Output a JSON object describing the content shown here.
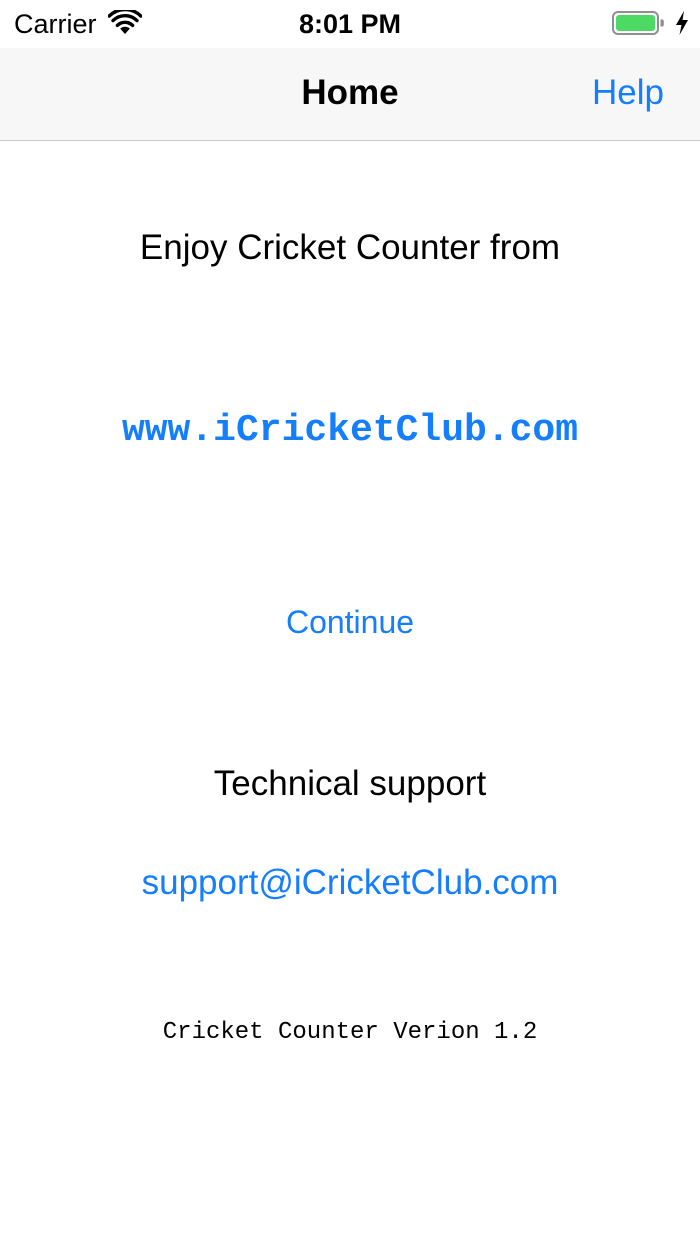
{
  "status_bar": {
    "carrier": "Carrier",
    "time": "8:01 PM",
    "wifi_icon": "wifi-icon",
    "battery_icon": "battery-icon",
    "charging_icon": "charging-bolt-icon",
    "battery_level": 1.0,
    "battery_color": "#4cd964"
  },
  "nav": {
    "title": "Home",
    "help_label": "Help"
  },
  "content": {
    "enjoy_text": "Enjoy Cricket Counter from",
    "site_link": "www.iCricketClub.com",
    "continue_label": "Continue",
    "support_heading": "Technical support",
    "support_email": "support@iCricketClub.com",
    "version_text": "Cricket Counter Verion 1.2"
  },
  "colors": {
    "accent": "#157efb",
    "nav_background": "#f7f7f7",
    "text": "#000000",
    "background": "#ffffff"
  }
}
